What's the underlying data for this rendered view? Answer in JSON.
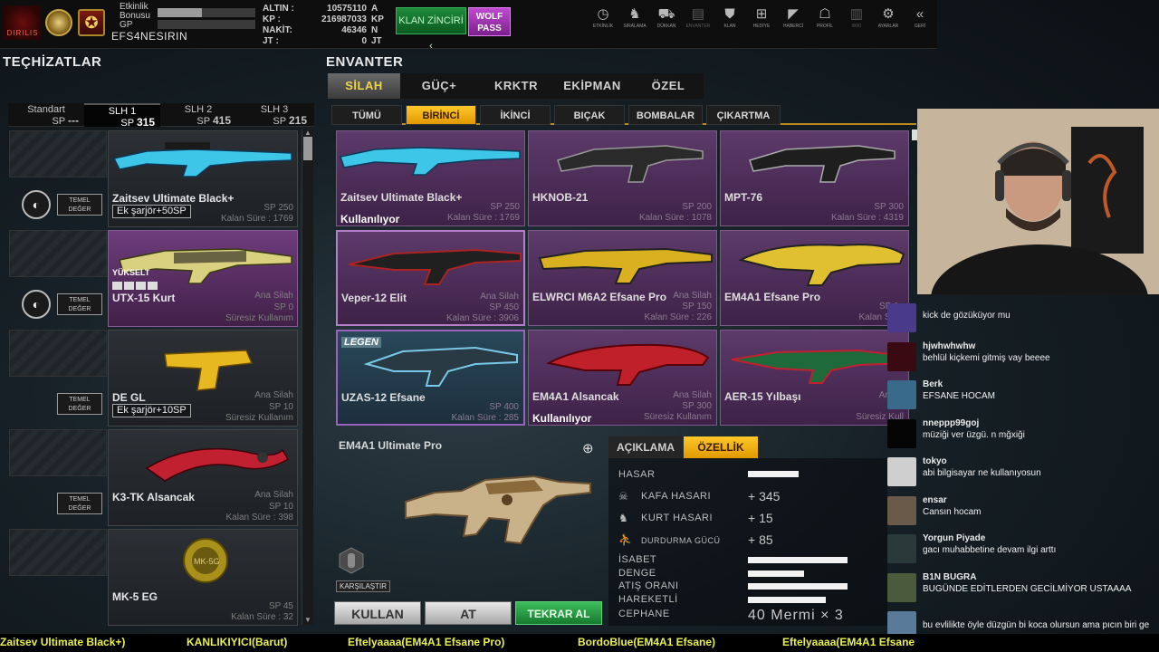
{
  "header": {
    "logo_text": "DIRILIS",
    "bonus_label": "Etkinlik Bonusu",
    "bonus_progress": 0.45,
    "gp_label": "GP",
    "gp_progress": 0.0,
    "player_name": "EFS4NESIRIN",
    "currencies": [
      {
        "label": "ALTIN :",
        "value": "10575110",
        "unit": "A"
      },
      {
        "label": "KP :",
        "value": "216987033",
        "unit": "KP"
      },
      {
        "label": "NAKİT:",
        "value": "46346",
        "unit": "N"
      },
      {
        "label": "JT :",
        "value": "0",
        "unit": "JT"
      }
    ],
    "klan_button": "KLAN ZİNCİRİ",
    "wolf_pass_line1": "WOLF",
    "wolf_pass_line2": "PASS",
    "nav": [
      {
        "label": "ETKİNLİK",
        "icon": "clock-icon",
        "glyph": "◷"
      },
      {
        "label": "SIRALAMA",
        "icon": "wolf-icon",
        "glyph": "♞"
      },
      {
        "label": "DÜKKAN",
        "icon": "cart-icon",
        "glyph": "⛟"
      },
      {
        "label": "ENVANTER",
        "icon": "briefcase-icon",
        "glyph": "▤"
      },
      {
        "label": "KLAN",
        "icon": "clan-shield-icon",
        "glyph": "⛊"
      },
      {
        "label": "HEDİYE",
        "icon": "gift-icon",
        "glyph": "⊞"
      },
      {
        "label": "HABERCİ",
        "icon": "megaphone-icon",
        "glyph": "◤"
      },
      {
        "label": "PROFİL",
        "icon": "profile-icon",
        "glyph": "☖"
      },
      {
        "label": "WIKI",
        "icon": "wiki-icon",
        "glyph": "▥"
      },
      {
        "label": "AYARLAR",
        "icon": "gear-icon",
        "glyph": "⚙"
      },
      {
        "label": "GERİ",
        "icon": "back-icon",
        "glyph": "«"
      }
    ]
  },
  "left": {
    "title": "TEÇHİZATLAR",
    "tabs": [
      {
        "name": "Standart",
        "sp_label": "SP",
        "sp": "---"
      },
      {
        "name": "SLH 1",
        "sp_label": "SP",
        "sp": "315"
      },
      {
        "name": "SLH 2",
        "sp_label": "SP",
        "sp": "415"
      },
      {
        "name": "SLH 3",
        "sp_label": "SP",
        "sp": "215"
      }
    ],
    "temel_line1": "TEMEL",
    "temel_line2": "DEĞER",
    "equipped": [
      {
        "name": "Zaitsev Ultimate Black+",
        "tag": "Ek şarjör+50SP",
        "meta1": "SP 250",
        "meta2": "Kalan Süre : 1769"
      },
      {
        "name": "UTX-15 Kurt",
        "badge": "YÜKSELT",
        "meta0": "Ana Silah",
        "meta1": "SP 0",
        "meta2": "Süresiz Kullanım"
      },
      {
        "name": "DE GL",
        "tag": "Ek şarjör+10SP",
        "meta0": "Ana Silah",
        "meta1": "SP 10",
        "meta2": "Süresiz Kullanım"
      },
      {
        "name": "K3-TK Alsancak",
        "meta0": "Ana Silah",
        "meta1": "SP 10",
        "meta2": "Kalan Süre : 398"
      },
      {
        "name": "MK-5 EG",
        "meta1": "SP 45",
        "meta2": "Kalan Süre : 32"
      }
    ]
  },
  "inventory": {
    "title": "ENVANTER",
    "main_tabs": [
      "SİLAH",
      "GÜÇ+",
      "KRKTR",
      "EKİPMAN",
      "ÖZEL"
    ],
    "sub_tabs": [
      "TÜMÜ",
      "BİRİNCİ",
      "İKİNCİ",
      "BIÇAK",
      "BOMBALAR",
      "ÇIKARTMA"
    ],
    "items": [
      {
        "name": "Zaitsev Ultimate Black+",
        "meta0": "",
        "meta1": "SP 250",
        "meta2": "Kalan Süre : 1769",
        "used": "Kullanılıyor"
      },
      {
        "name": "HKNOB-21",
        "meta0": "",
        "meta1": "SP 200",
        "meta2": "Kalan Süre : 1078",
        "used": ""
      },
      {
        "name": "MPT-76",
        "meta0": "",
        "meta1": "SP 300",
        "meta2": "Kalan Süre : 4319",
        "used": ""
      },
      {
        "name": "Veper-12 Elit",
        "meta0": "Ana Silah",
        "meta1": "SP 450",
        "meta2": "Kalan Süre : 3906",
        "used": ""
      },
      {
        "name": "ELWRCI M6A2 Efsane Pro",
        "meta0": "Ana Silah",
        "meta1": "SP 150",
        "meta2": "Kalan Süre : 226",
        "used": ""
      },
      {
        "name": "EM4A1 Efsane Pro",
        "meta0": "",
        "meta1": "SP 1..",
        "meta2": "Kalan Süre",
        "used": ""
      },
      {
        "name": "UZAS-12 Efsane",
        "meta0": "",
        "meta1": "SP 400",
        "meta2": "Kalan Süre : 285",
        "used": "",
        "badge": "LEGEN"
      },
      {
        "name": "EM4A1 Alsancak",
        "meta0": "Ana Silah",
        "meta1": "SP 300",
        "meta2": "Süresiz Kullanım",
        "used": "Kullanılıyor"
      },
      {
        "name": "AER-15 Yılbaşı",
        "meta0": "Ana S",
        "meta1": "",
        "meta2": "Süresiz Kull",
        "used": ""
      }
    ]
  },
  "detail": {
    "name": "EM4A1 Ultimate Pro",
    "compare": "KARŞILAŞTIR",
    "tabs": [
      "AÇIKLAMA",
      "ÖZELLİK"
    ],
    "hasar": {
      "label": "HASAR",
      "fill": 0.38
    },
    "sub_stats": [
      {
        "label": "KAFA HASARI",
        "value": "+ 345",
        "icon": "skull-icon",
        "glyph": "☠"
      },
      {
        "label": "KURT HASARI",
        "value": "+ 15",
        "icon": "wolf-head-icon",
        "glyph": "♞"
      },
      {
        "label": "DURDURMA GÜCÜ",
        "value": "+ 85",
        "icon": "walker-icon",
        "glyph": "⛹"
      }
    ],
    "bars": [
      {
        "label": "İSABET",
        "fill": 0.74
      },
      {
        "label": "DENGE",
        "fill": 0.42
      },
      {
        "label": "ATIŞ ORANI",
        "fill": 0.74
      },
      {
        "label": "HAREKETLİ",
        "fill": 0.58
      }
    ],
    "cephane_label": "CEPHANE",
    "cephane_value": "40 Mermi × 3",
    "buttons": {
      "use": "KULLAN",
      "drop": "AT",
      "rebuy": "TEKRAR AL"
    }
  },
  "chat": [
    {
      "user": "",
      "text": "kick de gözüküyor mu",
      "color": "#4a3a8a"
    },
    {
      "user": "hjwhwhwhw",
      "text": "behlül kiçkemi gitmiş vay beeee",
      "color": "#3a0a12"
    },
    {
      "user": "Berk",
      "text": "EFSANE HOCAM",
      "color": "#3a6a8a"
    },
    {
      "user": "nneppp99goj",
      "text": "müziği ver üzgü. n mğxiği",
      "color": "#050505"
    },
    {
      "user": "tokyo",
      "text": "abi bilgisayar ne kullanıyosun",
      "color": "#cfcfcf"
    },
    {
      "user": "ensar",
      "text": "Cansın hocam",
      "color": "#6a5a4a"
    },
    {
      "user": "Yorgun Piyade",
      "text": "gacı muhabbetine devam ilgi arttı",
      "color": "#2a3a3a"
    },
    {
      "user": "B1N BUGRA",
      "text": "BUGÜNDE EDİTLERDEN GECİLMİYOR USTAAAA",
      "color": "#4a5a3a"
    },
    {
      "user": "",
      "text": "bu evlilikte öyle düzgün bi koca olursun ama pıcın biri ge",
      "color": "#5a7a9a"
    }
  ],
  "ticker": [
    "Zaitsev Ultimate Black+)",
    "KANLIKIYICI(Barut)",
    "Eftelyaaaa(EM4A1 Efsane Pro)",
    "BordoBlue(EM4A1 Efsane)",
    "Eftelyaaaa(EM4A1 Efsane"
  ]
}
